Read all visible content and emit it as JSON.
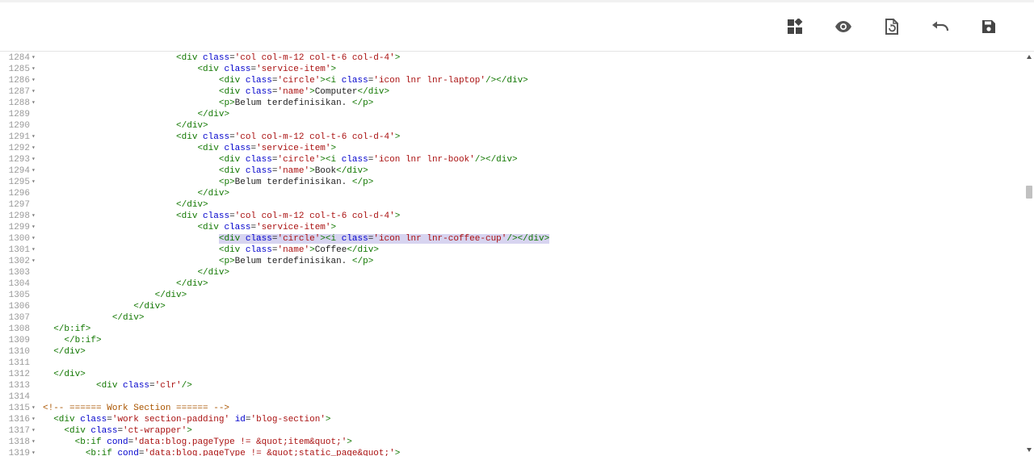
{
  "toolbar": {
    "buttons": [
      {
        "name": "layout-widgets-button",
        "icon": "widgets-icon"
      },
      {
        "name": "preview-button",
        "icon": "eye-icon"
      },
      {
        "name": "revert-button",
        "icon": "file-restore-icon"
      },
      {
        "name": "undo-button",
        "icon": "undo-icon"
      },
      {
        "name": "save-button",
        "icon": "save-icon"
      }
    ]
  },
  "colors": {
    "tag": "#117700",
    "attribute": "#0000cc",
    "string": "#aa1111",
    "comment": "#aa5500",
    "text": "#222222",
    "line_number": "#999999",
    "selection": "#d7d4f0",
    "icon": "#555555"
  },
  "editor": {
    "lines": [
      {
        "num": "1284",
        "fold": true,
        "segments": [
          [
            "p",
            "                         "
          ],
          [
            "t",
            "<div"
          ],
          [
            "p",
            " "
          ],
          [
            "a",
            "class"
          ],
          [
            "p",
            "="
          ],
          [
            "s",
            "'col col-m-12 col-t-6 col-d-4'"
          ],
          [
            "t",
            ">"
          ]
        ]
      },
      {
        "num": "1285",
        "fold": true,
        "segments": [
          [
            "p",
            "                             "
          ],
          [
            "t",
            "<div"
          ],
          [
            "p",
            " "
          ],
          [
            "a",
            "class"
          ],
          [
            "p",
            "="
          ],
          [
            "s",
            "'service-item'"
          ],
          [
            "t",
            ">"
          ]
        ]
      },
      {
        "num": "1286",
        "fold": true,
        "segments": [
          [
            "p",
            "                                 "
          ],
          [
            "t",
            "<div"
          ],
          [
            "p",
            " "
          ],
          [
            "a",
            "class"
          ],
          [
            "p",
            "="
          ],
          [
            "s",
            "'circle'"
          ],
          [
            "t",
            "><i"
          ],
          [
            "p",
            " "
          ],
          [
            "a",
            "class"
          ],
          [
            "p",
            "="
          ],
          [
            "s",
            "'icon lnr lnr-laptop'"
          ],
          [
            "t",
            "/></div>"
          ]
        ]
      },
      {
        "num": "1287",
        "fold": true,
        "segments": [
          [
            "p",
            "                                 "
          ],
          [
            "t",
            "<div"
          ],
          [
            "p",
            " "
          ],
          [
            "a",
            "class"
          ],
          [
            "p",
            "="
          ],
          [
            "s",
            "'name'"
          ],
          [
            "t",
            ">"
          ],
          [
            "p",
            "Computer"
          ],
          [
            "t",
            "</div>"
          ]
        ]
      },
      {
        "num": "1288",
        "fold": true,
        "segments": [
          [
            "p",
            "                                 "
          ],
          [
            "t",
            "<p>"
          ],
          [
            "p",
            "Belum terdefinisikan. "
          ],
          [
            "t",
            "</p>"
          ]
        ]
      },
      {
        "num": "1289",
        "fold": false,
        "segments": [
          [
            "p",
            "                             "
          ],
          [
            "t",
            "</div>"
          ]
        ]
      },
      {
        "num": "1290",
        "fold": false,
        "segments": [
          [
            "p",
            "                         "
          ],
          [
            "t",
            "</div>"
          ]
        ]
      },
      {
        "num": "1291",
        "fold": true,
        "segments": [
          [
            "p",
            "                         "
          ],
          [
            "t",
            "<div"
          ],
          [
            "p",
            " "
          ],
          [
            "a",
            "class"
          ],
          [
            "p",
            "="
          ],
          [
            "s",
            "'col col-m-12 col-t-6 col-d-4'"
          ],
          [
            "t",
            ">"
          ]
        ]
      },
      {
        "num": "1292",
        "fold": true,
        "segments": [
          [
            "p",
            "                             "
          ],
          [
            "t",
            "<div"
          ],
          [
            "p",
            " "
          ],
          [
            "a",
            "class"
          ],
          [
            "p",
            "="
          ],
          [
            "s",
            "'service-item'"
          ],
          [
            "t",
            ">"
          ]
        ]
      },
      {
        "num": "1293",
        "fold": true,
        "segments": [
          [
            "p",
            "                                 "
          ],
          [
            "t",
            "<div"
          ],
          [
            "p",
            " "
          ],
          [
            "a",
            "class"
          ],
          [
            "p",
            "="
          ],
          [
            "s",
            "'circle'"
          ],
          [
            "t",
            "><i"
          ],
          [
            "p",
            " "
          ],
          [
            "a",
            "class"
          ],
          [
            "p",
            "="
          ],
          [
            "s",
            "'icon lnr lnr-book'"
          ],
          [
            "t",
            "/></div>"
          ]
        ]
      },
      {
        "num": "1294",
        "fold": true,
        "segments": [
          [
            "p",
            "                                 "
          ],
          [
            "t",
            "<div"
          ],
          [
            "p",
            " "
          ],
          [
            "a",
            "class"
          ],
          [
            "p",
            "="
          ],
          [
            "s",
            "'name'"
          ],
          [
            "t",
            ">"
          ],
          [
            "p",
            "Book"
          ],
          [
            "t",
            "</div>"
          ]
        ]
      },
      {
        "num": "1295",
        "fold": true,
        "segments": [
          [
            "p",
            "                                 "
          ],
          [
            "t",
            "<p>"
          ],
          [
            "p",
            "Belum terdefinisikan. "
          ],
          [
            "t",
            "</p>"
          ]
        ]
      },
      {
        "num": "1296",
        "fold": false,
        "segments": [
          [
            "p",
            "                             "
          ],
          [
            "t",
            "</div>"
          ]
        ]
      },
      {
        "num": "1297",
        "fold": false,
        "segments": [
          [
            "p",
            "                         "
          ],
          [
            "t",
            "</div>"
          ]
        ]
      },
      {
        "num": "1298",
        "fold": true,
        "segments": [
          [
            "p",
            "                         "
          ],
          [
            "t",
            "<div"
          ],
          [
            "p",
            " "
          ],
          [
            "a",
            "class"
          ],
          [
            "p",
            "="
          ],
          [
            "s",
            "'col col-m-12 col-t-6 col-d-4'"
          ],
          [
            "t",
            ">"
          ]
        ]
      },
      {
        "num": "1299",
        "fold": true,
        "segments": [
          [
            "p",
            "                             "
          ],
          [
            "t",
            "<div"
          ],
          [
            "p",
            " "
          ],
          [
            "a",
            "class"
          ],
          [
            "p",
            "="
          ],
          [
            "s",
            "'service-item'"
          ],
          [
            "t",
            ">"
          ]
        ]
      },
      {
        "num": "1300",
        "fold": true,
        "highlight_from": 1,
        "segments": [
          [
            "p",
            "                                 "
          ],
          [
            "t",
            "<div"
          ],
          [
            "p",
            " "
          ],
          [
            "a",
            "class"
          ],
          [
            "p",
            "="
          ],
          [
            "s",
            "'circle'"
          ],
          [
            "t",
            "><i"
          ],
          [
            "p",
            " "
          ],
          [
            "a",
            "class"
          ],
          [
            "p",
            "="
          ],
          [
            "s",
            "'icon lnr lnr-coffee-cup'"
          ],
          [
            "t",
            "/></div>"
          ]
        ]
      },
      {
        "num": "1301",
        "fold": true,
        "segments": [
          [
            "p",
            "                                 "
          ],
          [
            "t",
            "<div"
          ],
          [
            "p",
            " "
          ],
          [
            "a",
            "class"
          ],
          [
            "p",
            "="
          ],
          [
            "s",
            "'name'"
          ],
          [
            "t",
            ">"
          ],
          [
            "p",
            "Coffee"
          ],
          [
            "t",
            "</div>"
          ]
        ]
      },
      {
        "num": "1302",
        "fold": true,
        "segments": [
          [
            "p",
            "                                 "
          ],
          [
            "t",
            "<p>"
          ],
          [
            "p",
            "Belum terdefinisikan. "
          ],
          [
            "t",
            "</p>"
          ]
        ]
      },
      {
        "num": "1303",
        "fold": false,
        "segments": [
          [
            "p",
            "                             "
          ],
          [
            "t",
            "</div>"
          ]
        ]
      },
      {
        "num": "1304",
        "fold": false,
        "segments": [
          [
            "p",
            "                         "
          ],
          [
            "t",
            "</div>"
          ]
        ]
      },
      {
        "num": "1305",
        "fold": false,
        "segments": [
          [
            "p",
            "                     "
          ],
          [
            "t",
            "</div>"
          ]
        ]
      },
      {
        "num": "1306",
        "fold": false,
        "segments": [
          [
            "p",
            "                 "
          ],
          [
            "t",
            "</div>"
          ]
        ]
      },
      {
        "num": "1307",
        "fold": false,
        "segments": [
          [
            "p",
            "             "
          ],
          [
            "t",
            "</div>"
          ]
        ]
      },
      {
        "num": "1308",
        "fold": false,
        "segments": [
          [
            "p",
            "  "
          ],
          [
            "t",
            "</b:if>"
          ]
        ]
      },
      {
        "num": "1309",
        "fold": false,
        "segments": [
          [
            "p",
            "    "
          ],
          [
            "t",
            "</b:if>"
          ]
        ]
      },
      {
        "num": "1310",
        "fold": false,
        "segments": [
          [
            "p",
            "  "
          ],
          [
            "t",
            "</div>"
          ]
        ]
      },
      {
        "num": "1311",
        "fold": false,
        "segments": []
      },
      {
        "num": "1312",
        "fold": false,
        "segments": [
          [
            "p",
            "  "
          ],
          [
            "t",
            "</div>"
          ]
        ]
      },
      {
        "num": "1313",
        "fold": false,
        "segments": [
          [
            "p",
            "          "
          ],
          [
            "t",
            "<div"
          ],
          [
            "p",
            " "
          ],
          [
            "a",
            "class"
          ],
          [
            "p",
            "="
          ],
          [
            "s",
            "'clr'"
          ],
          [
            "t",
            "/>"
          ]
        ]
      },
      {
        "num": "1314",
        "fold": false,
        "segments": []
      },
      {
        "num": "1315",
        "fold": true,
        "segments": [
          [
            "c",
            "<!-- ====== Work Section ====== -->"
          ]
        ]
      },
      {
        "num": "1316",
        "fold": true,
        "segments": [
          [
            "p",
            "  "
          ],
          [
            "t",
            "<div"
          ],
          [
            "p",
            " "
          ],
          [
            "a",
            "class"
          ],
          [
            "p",
            "="
          ],
          [
            "s",
            "'work section-padding'"
          ],
          [
            "p",
            " "
          ],
          [
            "a",
            "id"
          ],
          [
            "p",
            "="
          ],
          [
            "s",
            "'blog-section'"
          ],
          [
            "t",
            ">"
          ]
        ]
      },
      {
        "num": "1317",
        "fold": true,
        "segments": [
          [
            "p",
            "    "
          ],
          [
            "t",
            "<div"
          ],
          [
            "p",
            " "
          ],
          [
            "a",
            "class"
          ],
          [
            "p",
            "="
          ],
          [
            "s",
            "'ct-wrapper'"
          ],
          [
            "t",
            ">"
          ]
        ]
      },
      {
        "num": "1318",
        "fold": true,
        "segments": [
          [
            "p",
            "      "
          ],
          [
            "t",
            "<b:if"
          ],
          [
            "p",
            " "
          ],
          [
            "a",
            "cond"
          ],
          [
            "p",
            "="
          ],
          [
            "s",
            "'data:blog.pageType != &quot;item&quot;'"
          ],
          [
            "t",
            ">"
          ]
        ]
      },
      {
        "num": "1319",
        "fold": true,
        "segments": [
          [
            "p",
            "        "
          ],
          [
            "t",
            "<b:if"
          ],
          [
            "p",
            " "
          ],
          [
            "a",
            "cond"
          ],
          [
            "p",
            "="
          ],
          [
            "s",
            "'data:blog.pageType != &quot;static_page&quot;'"
          ],
          [
            "t",
            ">"
          ]
        ]
      }
    ]
  }
}
